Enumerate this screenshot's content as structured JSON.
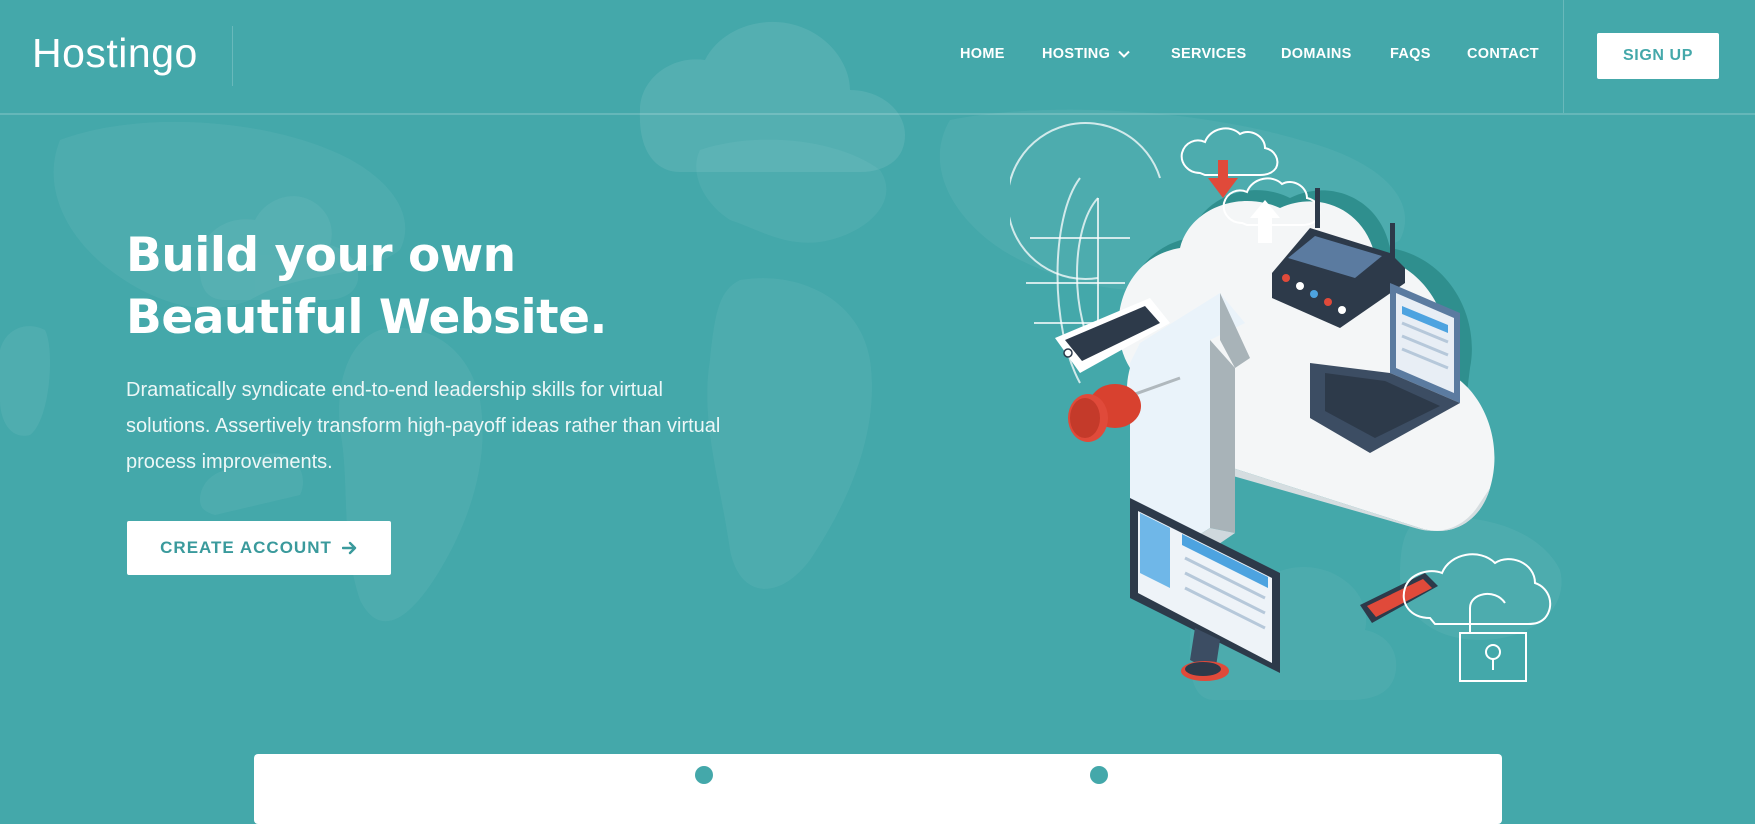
{
  "brand": {
    "name": "Hostingo"
  },
  "nav": {
    "items": [
      {
        "label": "HOME"
      },
      {
        "label": "HOSTING",
        "has_dropdown": true
      },
      {
        "label": "SERVICES"
      },
      {
        "label": "DOMAINS"
      },
      {
        "label": "FAQS"
      },
      {
        "label": "CONTACT"
      }
    ],
    "signup_label": "SIGN UP"
  },
  "hero": {
    "title_line1": "Build your own",
    "title_line2": "Beautiful Website.",
    "description": "Dramatically syndicate end-to-end leadership skills for virtual solutions. Assertively transform high-payoff ideas rather than virtual process improvements.",
    "cta_label": "CREATE ACCOUNT",
    "cta_icon": "arrow-right-icon"
  },
  "colors": {
    "background": "#44a8aa",
    "accent": "#44a8aa",
    "white": "#ffffff",
    "red": "#e04a3a",
    "navy": "#2d3a4a"
  }
}
